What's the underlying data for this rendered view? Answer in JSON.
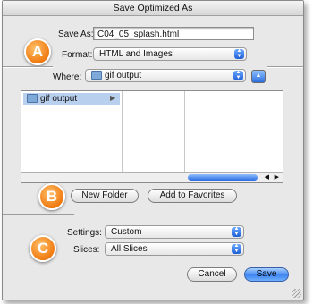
{
  "window": {
    "title": "Save Optimized As"
  },
  "save": {
    "save_as_label": "Save As:",
    "filename": "C04_05_splash.html",
    "format_label": "Format:",
    "format_value": "HTML and Images",
    "where_label": "Where:",
    "where_value": "gif output"
  },
  "browser": {
    "column_items": [
      {
        "label": "gif output",
        "selected": true
      }
    ]
  },
  "buttons": {
    "new_folder": "New Folder",
    "add_favorites": "Add to Favorites",
    "cancel": "Cancel",
    "save": "Save"
  },
  "options": {
    "settings_label": "Settings:",
    "settings_value": "Custom",
    "slices_label": "Slices:",
    "slices_value": "All Slices"
  },
  "badges": {
    "a": "A",
    "b": "B",
    "c": "C"
  },
  "colors": {
    "badge": "#f07a10",
    "accent": "#3f86f0",
    "selection": "#b9cfee"
  }
}
